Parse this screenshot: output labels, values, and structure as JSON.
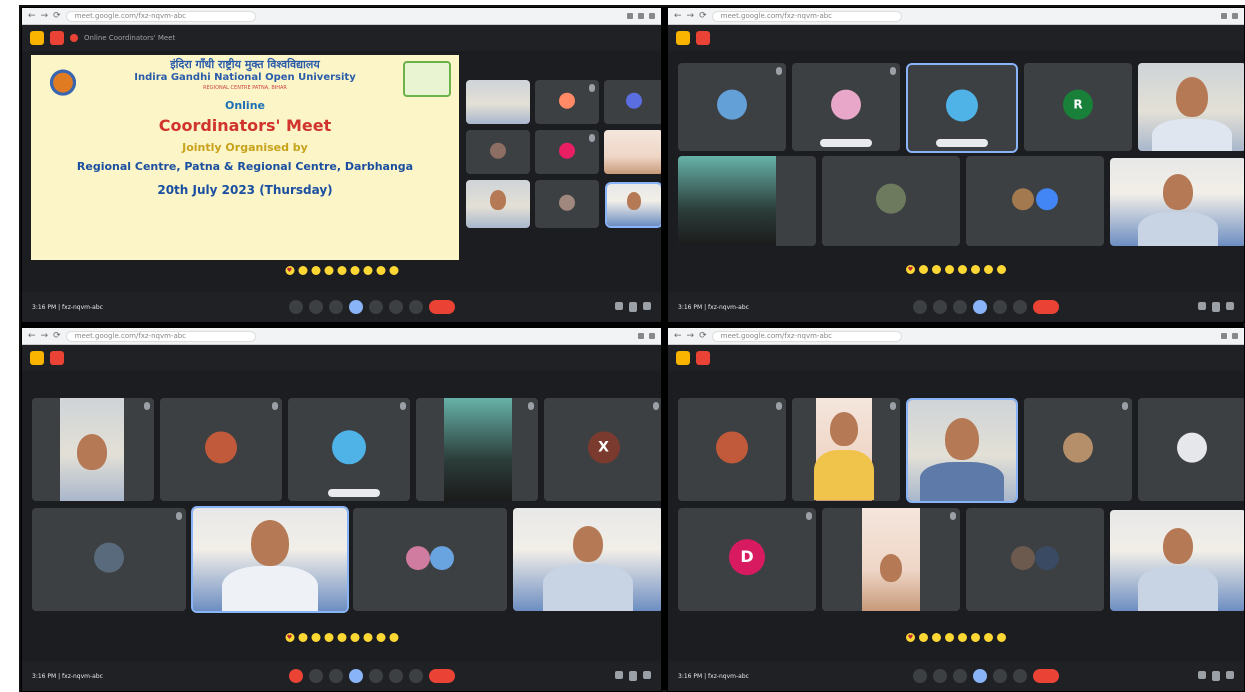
{
  "window": {
    "url": "meet.google.com/fxz-nqvm-abc",
    "tab_title": "Online Coordinators' Meet"
  },
  "meeting": {
    "title": "Online Coordinators' Meet",
    "time": "3:16 PM",
    "code": "fxz-nqvm-abc"
  },
  "slide": {
    "hindi_title": "इंदिरा गाँधी राष्ट्रीय मुक्त विश्वविद्यालय",
    "university": "Indira Gandhi National Open University",
    "address": "REGIONAL CENTRE PATNA, BIHAR",
    "line1": "Online",
    "line2": "Coordinators' Meet",
    "line3": "Jointly Organised by",
    "line4": "Regional Centre, Patna & Regional Centre, Darbhanga",
    "line5": "20th July 2023 (Thursday)"
  },
  "controls": {
    "end_call": "end-call-icon"
  },
  "colors": {
    "meet_dark": "#202124",
    "tile": "#3c4043",
    "accent_blue": "#8ab4f8",
    "end_red": "#ea4335",
    "slide_bg": "#fbf5c8"
  }
}
